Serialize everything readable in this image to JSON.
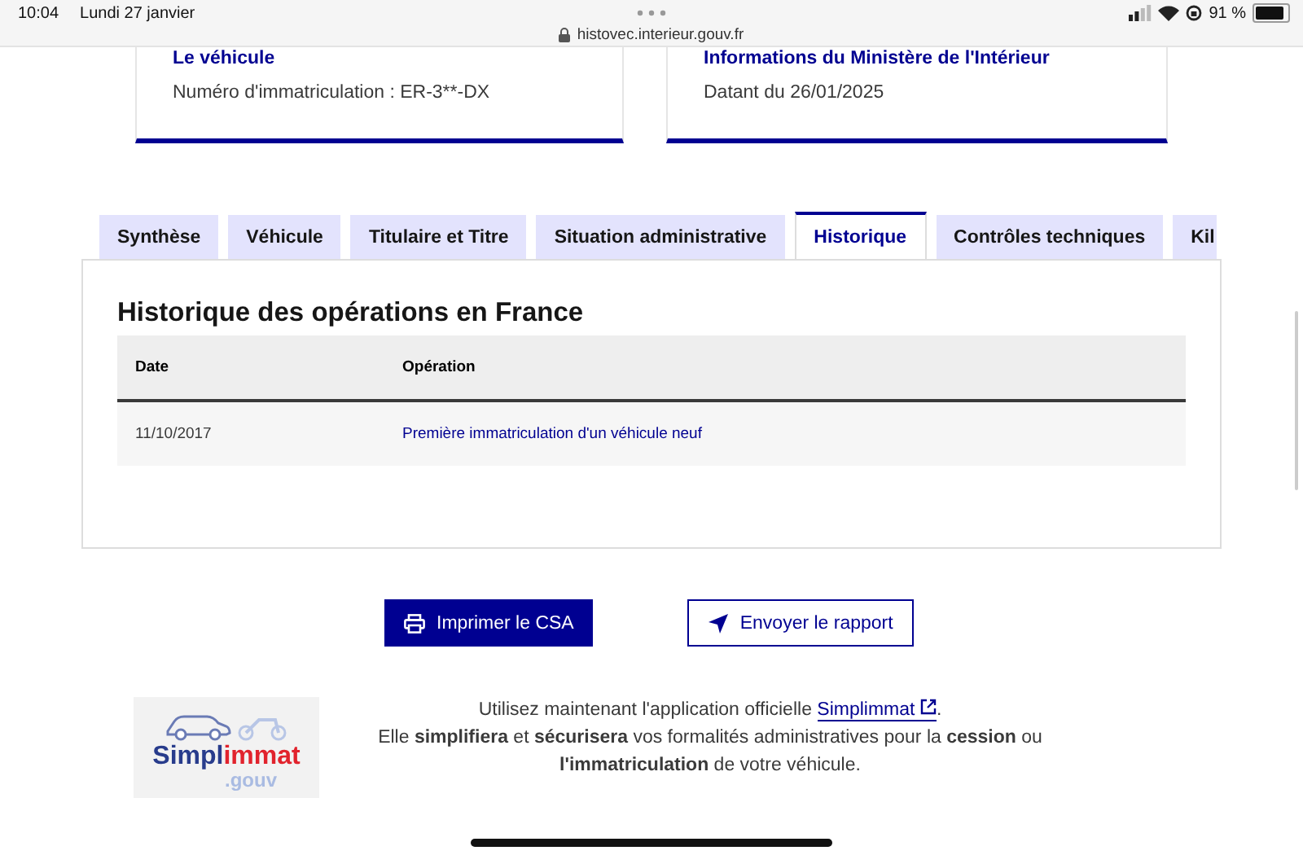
{
  "status_bar": {
    "time": "10:04",
    "date": "Lundi 27 janvier",
    "url": "histovec.interieur.gouv.fr",
    "battery": "91 %"
  },
  "cards": [
    {
      "title": "Le véhicule",
      "text": "Numéro d'immatriculation : ER-3**-DX"
    },
    {
      "title": "Informations du Ministère de l'Intérieur",
      "text": "Datant du 26/01/2025"
    }
  ],
  "tabs": [
    {
      "label": "Synthèse",
      "selected": false
    },
    {
      "label": "Véhicule",
      "selected": false
    },
    {
      "label": "Titulaire et Titre",
      "selected": false
    },
    {
      "label": "Situation administrative",
      "selected": false
    },
    {
      "label": "Historique",
      "selected": true
    },
    {
      "label": "Contrôles techniques",
      "selected": false
    },
    {
      "label": "Kil",
      "selected": false
    }
  ],
  "panel": {
    "title": "Historique des opérations en France",
    "table": {
      "columns": [
        "Date",
        "Opération"
      ],
      "rows": [
        {
          "date": "11/10/2017",
          "operation": "Première immatriculation d'un véhicule neuf"
        }
      ]
    }
  },
  "buttons": [
    {
      "label": "Imprimer le CSA",
      "kind": "primary"
    },
    {
      "label": "Envoyer le rapport",
      "kind": "secondary"
    }
  ],
  "promo": {
    "logo": {
      "part_1": "Simpl",
      "part_2": "immat",
      "suffix": ".gouv"
    },
    "line_1_prefix": "Utilisez maintenant l'application officielle ",
    "link": "Simplimmat",
    "line_1_suffix": ".",
    "line_2": "Elle **simplifiera** et **sécurisera** vos formalités administratives pour la **cession** ou **l'immatriculation** de votre véhicule."
  }
}
